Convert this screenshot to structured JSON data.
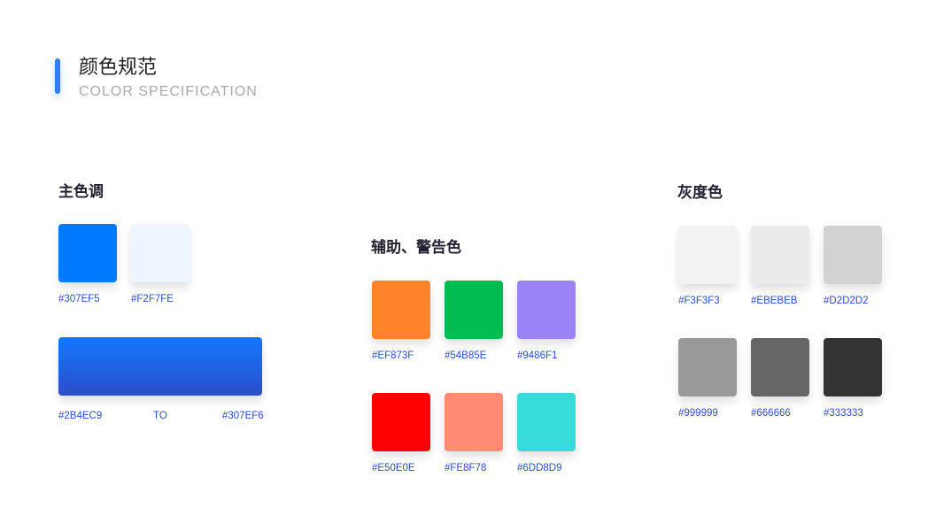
{
  "header": {
    "title": "颜色规范",
    "subtitle": "COLOR  SPECIFICATION",
    "accent_color": "#307EF5"
  },
  "primary": {
    "title": "主色调",
    "swatches": [
      {
        "code": "#307EF5",
        "color": "#007AFF"
      },
      {
        "code": "#F2F7FE",
        "color": "#EEF5FE"
      }
    ],
    "gradient": {
      "from": "#2B4EC9",
      "to_label": "TO",
      "to": "#307EF6",
      "from_color": "#2B4EC9",
      "to_color": "#1478FF"
    }
  },
  "auxiliary": {
    "title": "辅助、警告色",
    "swatches": [
      {
        "code": "#EF873F",
        "color": "#FF8329"
      },
      {
        "code": "#54B85E",
        "color": "#00BD52"
      },
      {
        "code": "#9486F1",
        "color": "#9B82F6"
      },
      {
        "code": "#E50E0E",
        "color": "#FF0000"
      },
      {
        "code": "#FE8F78",
        "color": "#FF8B75"
      },
      {
        "code": "#6DD8D9",
        "color": "#36DBDA"
      }
    ]
  },
  "gray": {
    "title": "灰度色",
    "swatches": [
      {
        "code": "#F3F3F3",
        "color": "#F3F3F3"
      },
      {
        "code": "#EBEBEB",
        "color": "#EBEBEB"
      },
      {
        "code": "#D2D2D2",
        "color": "#D2D2D2"
      },
      {
        "code": "#999999",
        "color": "#999999"
      },
      {
        "code": "#666666",
        "color": "#666666"
      },
      {
        "code": "#333333",
        "color": "#333333"
      }
    ]
  }
}
